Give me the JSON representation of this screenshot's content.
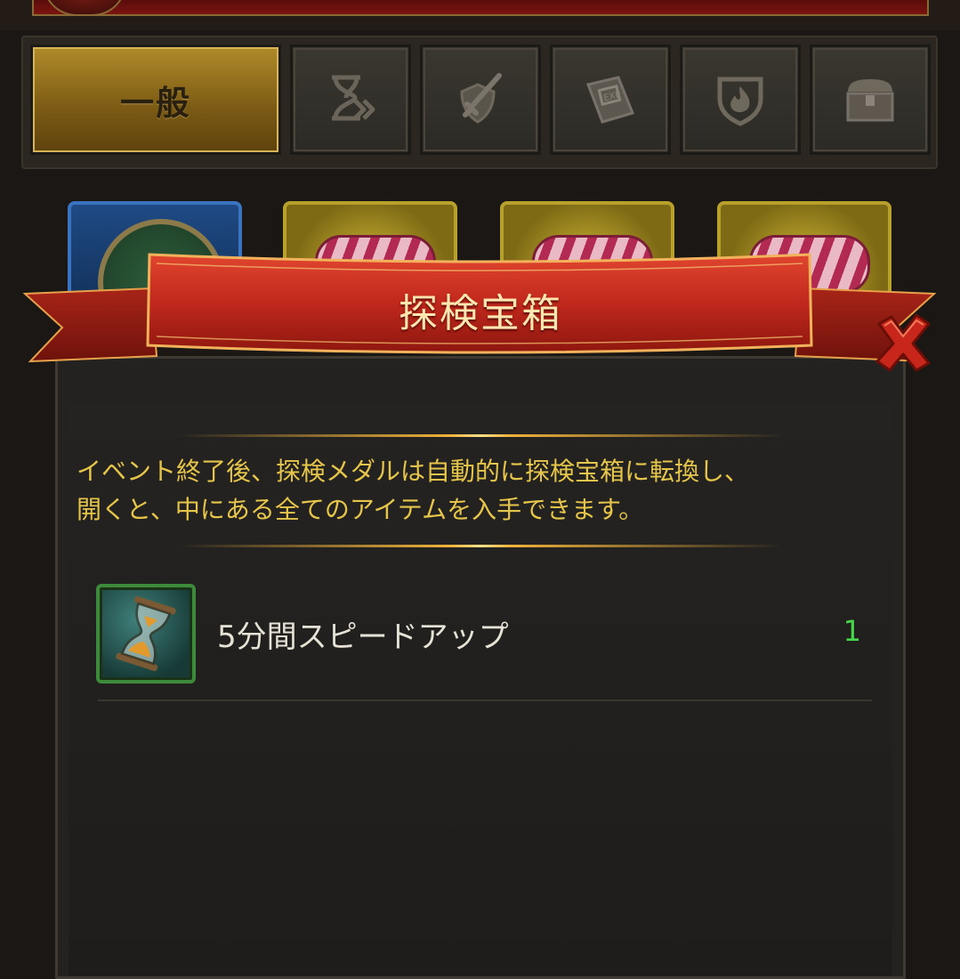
{
  "tabs": [
    {
      "label": "一般",
      "active": true
    },
    {
      "icon": "hourglass-speed-icon"
    },
    {
      "icon": "sword-shield-icon"
    },
    {
      "icon": "exp-book-icon"
    },
    {
      "icon": "fire-shield-icon"
    },
    {
      "icon": "treasure-chest-icon"
    }
  ],
  "dialog": {
    "title": "探検宝箱",
    "description_lines": [
      "イベント終了後、探検メダルは自動的に探検宝箱に転換し、",
      "開くと、中にある全てのアイテムを入手できます。"
    ],
    "items": [
      {
        "name": "5分間スピードアップ",
        "count": "1",
        "icon": "hourglass-icon"
      }
    ]
  },
  "colors": {
    "description_text": "#e6c64a",
    "count_text": "#46d84a",
    "ribbon": "#c0281c",
    "active_tab": "#9c7820"
  }
}
